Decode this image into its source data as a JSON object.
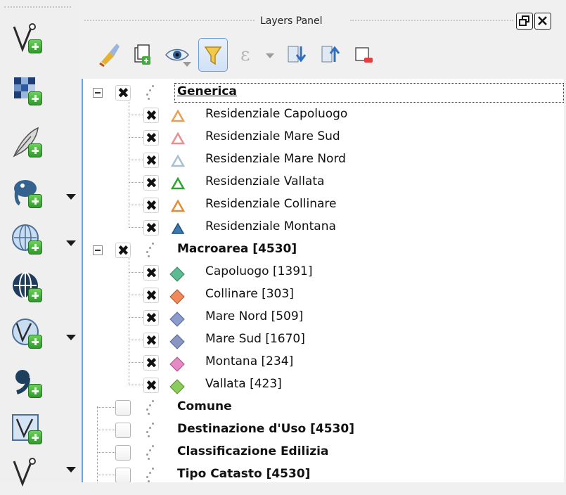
{
  "panel": {
    "title": "Layers Panel"
  },
  "left_toolbar": {
    "tools": [
      {
        "name": "add-vector-layer",
        "icon": "vector-layer-icon",
        "dropdown": false
      },
      {
        "name": "add-raster-layer",
        "icon": "raster-layer-icon",
        "dropdown": false
      },
      {
        "name": "add-delimited-text-layer",
        "icon": "feather-icon",
        "dropdown": false
      },
      {
        "name": "add-postgis-layer",
        "icon": "elephant-icon",
        "dropdown": true
      },
      {
        "name": "add-wms-layer",
        "icon": "globe-grid-icon",
        "dropdown": true
      },
      {
        "name": "add-wcs-layer",
        "icon": "globe-icon",
        "dropdown": false
      },
      {
        "name": "add-wfs-layer",
        "icon": "globe-vector-icon",
        "dropdown": true
      },
      {
        "name": "add-virtual-layer",
        "icon": "virtual-layer-icon",
        "dropdown": false
      },
      {
        "name": "add-virtual-layer-2",
        "icon": "virtual-layer-2-icon",
        "dropdown": false
      },
      {
        "name": "add-vector-layer-2",
        "icon": "vector-layer-icon",
        "dropdown": true
      }
    ]
  },
  "panel_toolbar": {
    "buttons": [
      {
        "name": "style-brush",
        "icon": "brush-icon"
      },
      {
        "name": "add-group",
        "icon": "add-group-icon"
      },
      {
        "name": "manage-visibility",
        "icon": "eye-icon"
      },
      {
        "name": "filter-legend",
        "icon": "filter-icon",
        "active": true
      },
      {
        "name": "filter-expression",
        "icon": "expression-icon",
        "disabled": true
      },
      {
        "name": "expand-all",
        "icon": "expand-all-icon"
      },
      {
        "name": "collapse-all",
        "icon": "collapse-all-icon"
      },
      {
        "name": "remove-layer",
        "icon": "remove-layer-icon"
      }
    ]
  },
  "tree": {
    "groups": [
      {
        "label": "Generica",
        "checked": true,
        "expanded": true,
        "selected": true,
        "items": [
          {
            "label": "Residenziale Capoluogo",
            "symbol": "triangle",
            "color": "#e8a050"
          },
          {
            "label": "Residenziale Mare Sud",
            "symbol": "triangle",
            "color": "#e89090"
          },
          {
            "label": "Residenziale Mare Nord",
            "symbol": "triangle",
            "color": "#a8c0d0"
          },
          {
            "label": "Residenziale Vallata",
            "symbol": "triangle",
            "color": "#30a030"
          },
          {
            "label": "Residenziale Collinare",
            "symbol": "triangle",
            "color": "#e88a30"
          },
          {
            "label": "Residenziale Montana",
            "symbol": "triangle",
            "color": "#3a7ab0"
          }
        ]
      },
      {
        "label": "Macroarea [4530]",
        "checked": true,
        "expanded": true,
        "items": [
          {
            "label": "Capoluogo [1391]",
            "symbol": "diamond",
            "color": "#5dbb94"
          },
          {
            "label": "Collinare [303]",
            "symbol": "diamond",
            "color": "#f08a5a"
          },
          {
            "label": "Mare Nord [509]",
            "symbol": "diamond",
            "color": "#8a9ccc"
          },
          {
            "label": "Mare Sud [1670]",
            "symbol": "diamond",
            "color": "#8a96c2"
          },
          {
            "label": "Montana [234]",
            "symbol": "diamond",
            "color": "#e68ac4"
          },
          {
            "label": "Vallata [423]",
            "symbol": "diamond",
            "color": "#8ccc5a"
          }
        ]
      },
      {
        "label": "Comune",
        "checked": false,
        "expanded": false,
        "items": []
      },
      {
        "label": "Destinazione d'Uso [4530]",
        "checked": false,
        "expanded": false,
        "items": []
      },
      {
        "label": "Classificazione Edilizia",
        "checked": false,
        "expanded": false,
        "items": []
      },
      {
        "label": "Tipo Catasto [4530]",
        "checked": false,
        "expanded": false,
        "items": []
      }
    ]
  }
}
